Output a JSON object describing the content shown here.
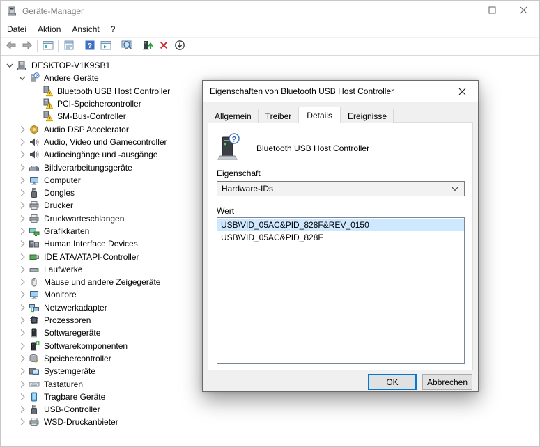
{
  "window": {
    "title": "Geräte-Manager",
    "controls": [
      {
        "name": "minimize-button",
        "icon": "minimize-icon"
      },
      {
        "name": "maximize-button",
        "icon": "maximize-icon"
      },
      {
        "name": "close-button",
        "icon": "close-icon"
      }
    ]
  },
  "menu": {
    "items": [
      "Datei",
      "Aktion",
      "Ansicht",
      "?"
    ]
  },
  "toolbar": {
    "items": [
      "back",
      "forward",
      "sep",
      "console-tree",
      "sep",
      "properties",
      "sep",
      "help",
      "action-pane",
      "sep",
      "scan-hardware",
      "sep",
      "update-driver",
      "uninstall",
      "disable"
    ]
  },
  "tree": {
    "items": [
      {
        "label": "DESKTOP-V1K9SB1",
        "level": 0,
        "state": "expanded",
        "icon": "computer-icon"
      },
      {
        "label": "Andere Geräte",
        "level": 1,
        "state": "expanded",
        "icon": "unknown-device-icon"
      },
      {
        "label": "Bluetooth USB Host Controller",
        "level": 2,
        "state": "none",
        "icon": "warning-device-icon"
      },
      {
        "label": "PCI-Speichercontroller",
        "level": 2,
        "state": "none",
        "icon": "warning-device-icon"
      },
      {
        "label": "SM-Bus-Controller",
        "level": 2,
        "state": "none",
        "icon": "warning-device-icon"
      },
      {
        "label": "Audio DSP Accelerator",
        "level": 1,
        "state": "collapsed",
        "icon": "dsp-icon"
      },
      {
        "label": "Audio, Video und Gamecontroller",
        "level": 1,
        "state": "collapsed",
        "icon": "speaker-icon"
      },
      {
        "label": "Audioeingänge und -ausgänge",
        "level": 1,
        "state": "collapsed",
        "icon": "speaker-icon"
      },
      {
        "label": "Bildverarbeitungsgeräte",
        "level": 1,
        "state": "collapsed",
        "icon": "imaging-icon"
      },
      {
        "label": "Computer",
        "level": 1,
        "state": "collapsed",
        "icon": "computer-monitor-icon"
      },
      {
        "label": "Dongles",
        "level": 1,
        "state": "collapsed",
        "icon": "usb-icon"
      },
      {
        "label": "Drucker",
        "level": 1,
        "state": "collapsed",
        "icon": "printer-icon"
      },
      {
        "label": "Druckwarteschlangen",
        "level": 1,
        "state": "collapsed",
        "icon": "printer-icon"
      },
      {
        "label": "Grafikkarten",
        "level": 1,
        "state": "collapsed",
        "icon": "gpu-icon"
      },
      {
        "label": "Human Interface Devices",
        "level": 1,
        "state": "collapsed",
        "icon": "hid-icon"
      },
      {
        "label": "IDE ATA/ATAPI-Controller",
        "level": 1,
        "state": "collapsed",
        "icon": "ide-icon"
      },
      {
        "label": "Laufwerke",
        "level": 1,
        "state": "collapsed",
        "icon": "drive-icon"
      },
      {
        "label": "Mäuse und andere Zeigegeräte",
        "level": 1,
        "state": "collapsed",
        "icon": "mouse-icon"
      },
      {
        "label": "Monitore",
        "level": 1,
        "state": "collapsed",
        "icon": "monitor-icon"
      },
      {
        "label": "Netzwerkadapter",
        "level": 1,
        "state": "collapsed",
        "icon": "network-icon"
      },
      {
        "label": "Prozessoren",
        "level": 1,
        "state": "collapsed",
        "icon": "cpu-icon"
      },
      {
        "label": "Softwaregeräte",
        "level": 1,
        "state": "collapsed",
        "icon": "software-device-icon"
      },
      {
        "label": "Softwarekomponenten",
        "level": 1,
        "state": "collapsed",
        "icon": "software-component-icon"
      },
      {
        "label": "Speichercontroller",
        "level": 1,
        "state": "collapsed",
        "icon": "storage-icon"
      },
      {
        "label": "Systemgeräte",
        "level": 1,
        "state": "collapsed",
        "icon": "system-icon"
      },
      {
        "label": "Tastaturen",
        "level": 1,
        "state": "collapsed",
        "icon": "keyboard-icon"
      },
      {
        "label": "Tragbare Geräte",
        "level": 1,
        "state": "collapsed",
        "icon": "portable-icon"
      },
      {
        "label": "USB-Controller",
        "level": 1,
        "state": "collapsed",
        "icon": "usb-icon"
      },
      {
        "label": "WSD-Druckanbieter",
        "level": 1,
        "state": "collapsed",
        "icon": "printer-icon"
      }
    ]
  },
  "dialog": {
    "title": "Eigenschaften von Bluetooth USB Host Controller",
    "tabs": [
      {
        "label": "Allgemein",
        "active": false
      },
      {
        "label": "Treiber",
        "active": false
      },
      {
        "label": "Details",
        "active": true
      },
      {
        "label": "Ereignisse",
        "active": false
      }
    ],
    "device_name": "Bluetooth USB Host Controller",
    "property_label": "Eigenschaft",
    "property_value": "Hardware-IDs",
    "value_label": "Wert",
    "values": [
      {
        "text": "USB\\VID_05AC&PID_828F&REV_0150",
        "selected": true
      },
      {
        "text": "USB\\VID_05AC&PID_828F",
        "selected": false
      }
    ],
    "buttons": {
      "ok": "OK",
      "cancel": "Abbrechen"
    }
  },
  "colors": {
    "accent": "#0078d7",
    "selection_bg": "#cde8ff",
    "warning_yellow": "#ffd633"
  }
}
